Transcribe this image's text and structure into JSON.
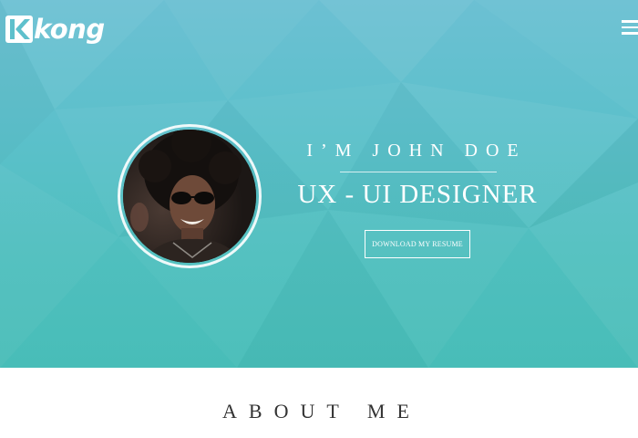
{
  "nav": {
    "logo_text": "kong",
    "logo_mark": "K",
    "menu_icon": "hamburger-icon"
  },
  "hero": {
    "greeting": "I’M JOHN DOE",
    "role": "UX - UI DESIGNER",
    "resume_button_label": "DOWNLOAD MY RESUME",
    "background_color_top": "#6cc0d3",
    "background_color_bottom": "#48bdb8"
  },
  "about": {
    "title": "ABOUT ME"
  }
}
